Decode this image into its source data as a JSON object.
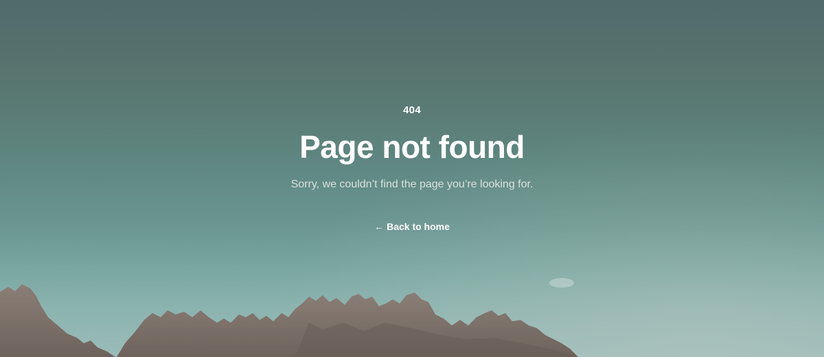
{
  "error": {
    "code": "404",
    "title": "Page not found",
    "message": "Sorry, we couldn’t find the page you’re looking for.",
    "back_link_label": "Back to home",
    "back_arrow": "←"
  },
  "colors": {
    "sky_top": "#4f6b6a",
    "sky_bottom": "#9bbcb8",
    "rock": "#7d716a",
    "text": "#ffffff",
    "subtitle": "#d6e1de"
  }
}
